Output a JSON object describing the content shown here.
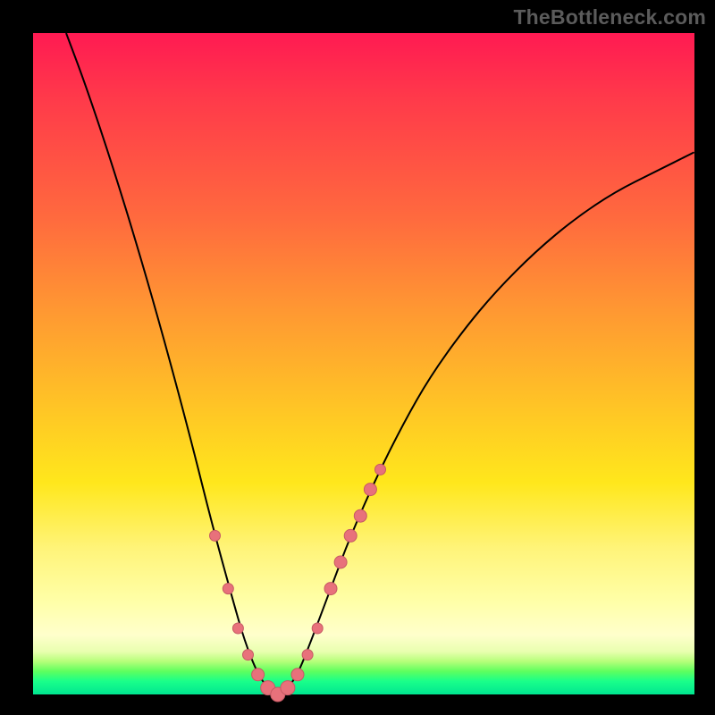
{
  "watermark": "TheBottleneck.com",
  "chart_data": {
    "type": "line",
    "title": "",
    "xlabel": "",
    "ylabel": "",
    "xlim": [
      0,
      100
    ],
    "ylim": [
      0,
      100
    ],
    "series": [
      {
        "name": "bottleneck-curve",
        "x": [
          5,
          8,
          12,
          16,
          20,
          24,
          27,
          30,
          32,
          34,
          35.5,
          37,
          38.5,
          40,
          42,
          45,
          48,
          52,
          56,
          60,
          65,
          70,
          76,
          82,
          88,
          94,
          100
        ],
        "y": [
          100,
          92,
          80,
          67,
          53,
          38,
          26,
          15,
          8,
          3,
          1,
          0,
          1,
          3,
          8,
          16,
          24,
          33,
          41,
          48,
          55,
          61,
          67,
          72,
          76,
          79,
          82
        ]
      }
    ],
    "markers": {
      "name": "highlighted-points",
      "points": [
        {
          "x": 27.5,
          "y": 24,
          "r": 6
        },
        {
          "x": 29.5,
          "y": 16,
          "r": 6
        },
        {
          "x": 31.0,
          "y": 10,
          "r": 6
        },
        {
          "x": 32.5,
          "y": 6,
          "r": 6
        },
        {
          "x": 34.0,
          "y": 3,
          "r": 7
        },
        {
          "x": 35.5,
          "y": 1,
          "r": 8
        },
        {
          "x": 37.0,
          "y": 0,
          "r": 8
        },
        {
          "x": 38.5,
          "y": 1,
          "r": 8
        },
        {
          "x": 40.0,
          "y": 3,
          "r": 7
        },
        {
          "x": 41.5,
          "y": 6,
          "r": 6
        },
        {
          "x": 43.0,
          "y": 10,
          "r": 6
        },
        {
          "x": 45.0,
          "y": 16,
          "r": 7
        },
        {
          "x": 46.5,
          "y": 20,
          "r": 7
        },
        {
          "x": 48.0,
          "y": 24,
          "r": 7
        },
        {
          "x": 49.5,
          "y": 27,
          "r": 7
        },
        {
          "x": 51.0,
          "y": 31,
          "r": 7
        },
        {
          "x": 52.5,
          "y": 34,
          "r": 6
        }
      ]
    },
    "gradient_stops": [
      {
        "pos": 0.0,
        "color": "#ff1a52"
      },
      {
        "pos": 0.28,
        "color": "#ff6a3e"
      },
      {
        "pos": 0.56,
        "color": "#ffc326"
      },
      {
        "pos": 0.78,
        "color": "#fff47a"
      },
      {
        "pos": 0.95,
        "color": "#b6ff7a"
      },
      {
        "pos": 1.0,
        "color": "#00e690"
      }
    ]
  }
}
